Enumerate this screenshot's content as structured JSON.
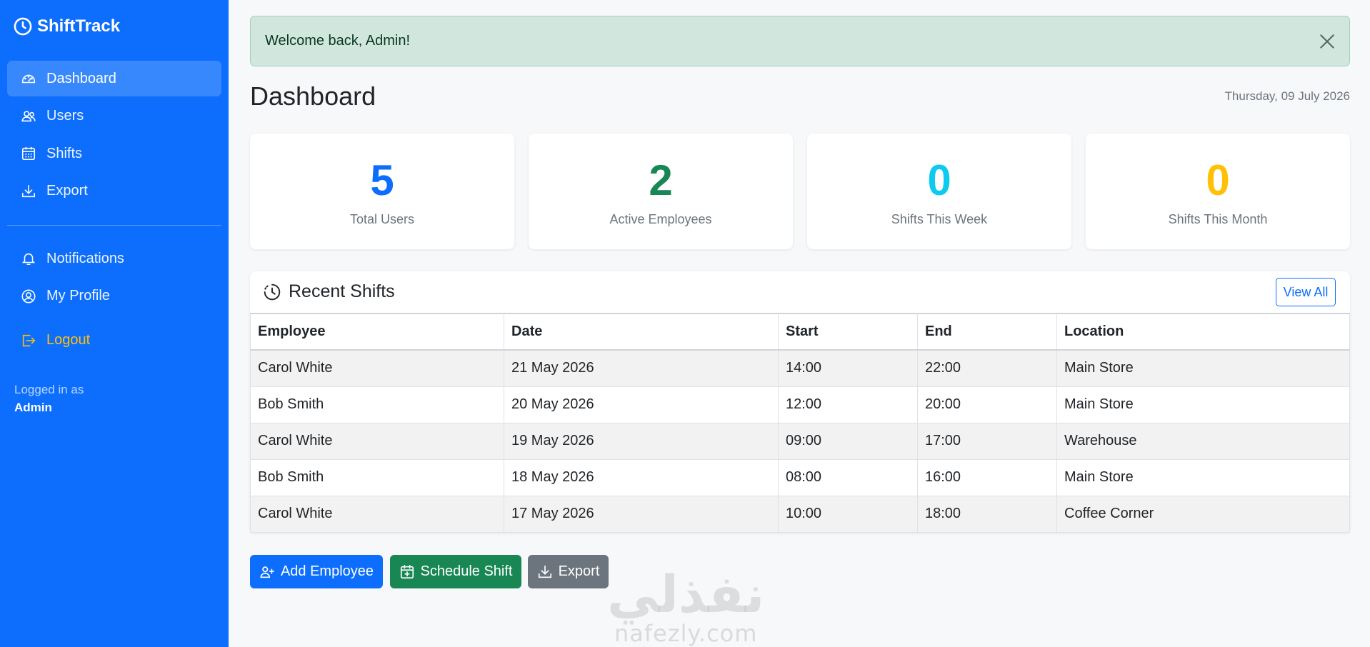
{
  "app": {
    "name": "ShiftTrack"
  },
  "sidebar": {
    "nav": [
      {
        "label": "Dashboard",
        "icon": "speedometer-icon",
        "active": true
      },
      {
        "label": "Users",
        "icon": "users-icon",
        "active": false
      },
      {
        "label": "Shifts",
        "icon": "calendar-grid-icon",
        "active": false
      },
      {
        "label": "Export",
        "icon": "download-icon",
        "active": false
      }
    ],
    "nav2": [
      {
        "label": "Notifications",
        "icon": "bell-icon"
      },
      {
        "label": "My Profile",
        "icon": "user-circle-icon"
      },
      {
        "label": "Logout",
        "icon": "logout-icon"
      }
    ],
    "logged_label": "Logged in as",
    "logged_user": "Admin"
  },
  "alert": {
    "message": "Welcome back, Admin!"
  },
  "page": {
    "title": "Dashboard",
    "date": "Thursday, 09 July 2026"
  },
  "stats": [
    {
      "value": "5",
      "label": "Total Users",
      "color": "#0d6efd"
    },
    {
      "value": "2",
      "label": "Active Employees",
      "color": "#198754"
    },
    {
      "value": "0",
      "label": "Shifts This Week",
      "color": "#0dcaf0"
    },
    {
      "value": "0",
      "label": "Shifts This Month",
      "color": "#ffc107"
    }
  ],
  "recent": {
    "title": "Recent Shifts",
    "view_all": "View All",
    "columns": [
      "Employee",
      "Date",
      "Start",
      "End",
      "Location"
    ],
    "rows": [
      [
        "Carol White",
        "21 May 2026",
        "14:00",
        "22:00",
        "Main Store"
      ],
      [
        "Bob Smith",
        "20 May 2026",
        "12:00",
        "20:00",
        "Main Store"
      ],
      [
        "Carol White",
        "19 May 2026",
        "09:00",
        "17:00",
        "Warehouse"
      ],
      [
        "Bob Smith",
        "18 May 2026",
        "08:00",
        "16:00",
        "Main Store"
      ],
      [
        "Carol White",
        "17 May 2026",
        "10:00",
        "18:00",
        "Coffee Corner"
      ]
    ]
  },
  "actions": {
    "add_employee": "Add Employee",
    "schedule_shift": "Schedule Shift",
    "export": "Export"
  },
  "watermark": {
    "arabic": "نفذلي",
    "latin": "nafezly.com"
  }
}
